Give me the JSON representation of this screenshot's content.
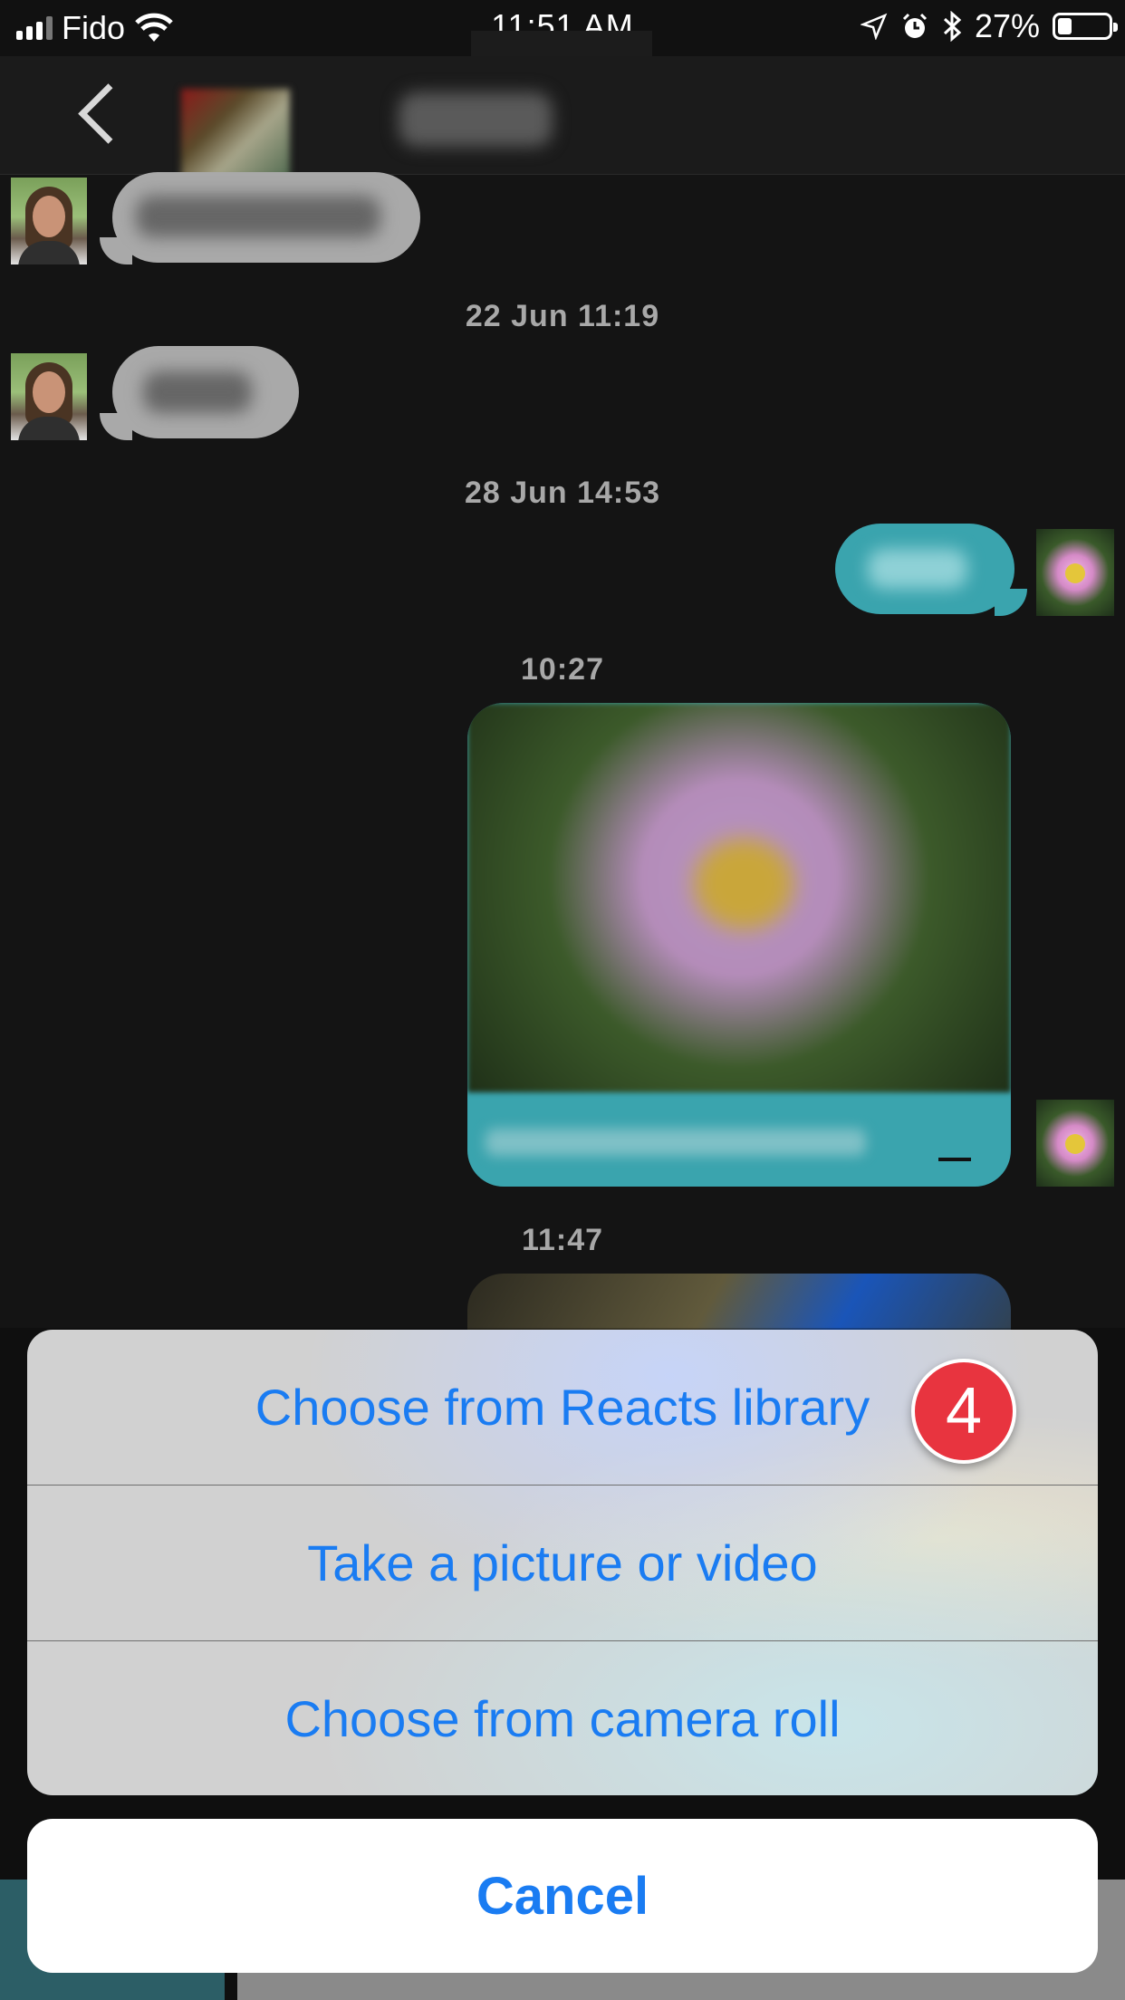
{
  "status_bar": {
    "carrier": "Fido",
    "time": "11:51 AM",
    "battery_percent": "27%",
    "battery_level": 0.27,
    "icons": [
      "signal-icon",
      "wifi-icon",
      "location-icon",
      "alarm-icon",
      "bluetooth-icon",
      "battery-icon"
    ]
  },
  "conversation": {
    "timestamps": [
      "22 Jun 11:19",
      "28 Jun 14:53",
      "10:27",
      "11:47"
    ]
  },
  "action_sheet": {
    "options": [
      "Choose from Reacts library",
      "Take a picture or video",
      "Choose from camera roll"
    ],
    "cancel_label": "Cancel",
    "step_badge": "4",
    "colors": {
      "action_text": "#1a7cf2",
      "badge": "#e8343f"
    }
  }
}
